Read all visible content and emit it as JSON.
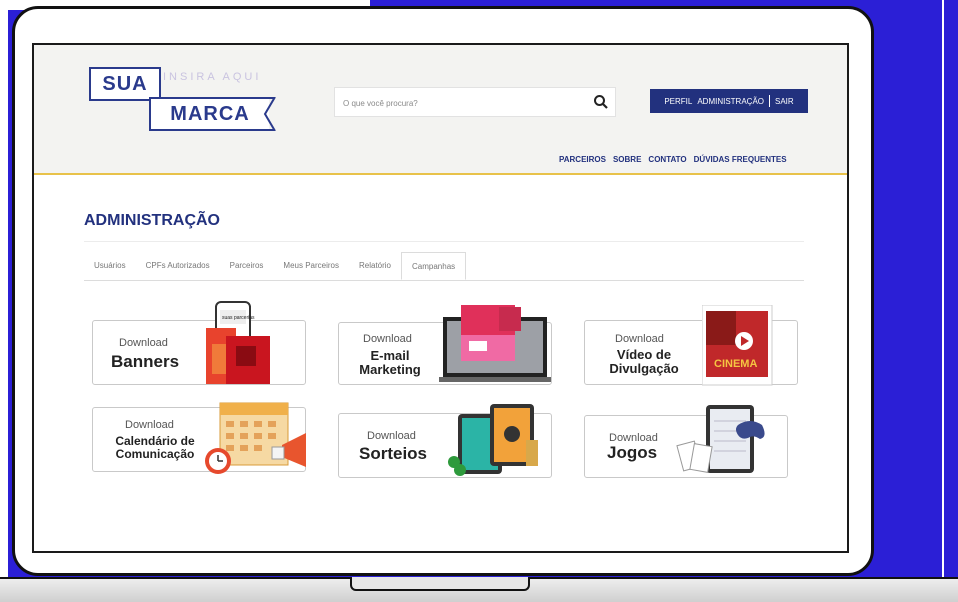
{
  "logo": {
    "top": "SUA",
    "tagline": "INSIRA AQUI",
    "bottom": "MARCA"
  },
  "search": {
    "placeholder": "O que você procura?"
  },
  "userbar": {
    "profile": "PERFIL",
    "admin": "ADMINISTRAÇÃO",
    "logout": "SAIR"
  },
  "topnav": [
    "PARCEIROS",
    "SOBRE",
    "CONTATO",
    "DÚVIDAS FREQUENTES"
  ],
  "page_title": "ADMINISTRAÇÃO",
  "tabs": [
    {
      "label": "Usuários",
      "active": false
    },
    {
      "label": "CPFs Autorizados",
      "active": false
    },
    {
      "label": "Parceiros",
      "active": false
    },
    {
      "label": "Meus Parceiros",
      "active": false
    },
    {
      "label": "Relatório",
      "active": false
    },
    {
      "label": "Campanhas",
      "active": true
    }
  ],
  "cards": [
    {
      "download": "Download",
      "title": [
        "Banners"
      ]
    },
    {
      "download": "Download",
      "title": [
        "E-mail",
        "Marketing"
      ]
    },
    {
      "download": "Download",
      "title": [
        "Vídeo de",
        "Divulgação"
      ]
    },
    {
      "download": "Download",
      "title": [
        "Calendário de",
        "Comunicação"
      ]
    },
    {
      "download": "Download",
      "title": [
        "Sorteios"
      ]
    },
    {
      "download": "Download",
      "title": [
        "Jogos"
      ]
    }
  ],
  "illustrations": {
    "phone_text": "suas parcerias",
    "video_text": "CINEMA"
  },
  "colors": {
    "background": "#2b1fd6",
    "brand": "#22317e",
    "header_rule": "#e8c24a"
  }
}
